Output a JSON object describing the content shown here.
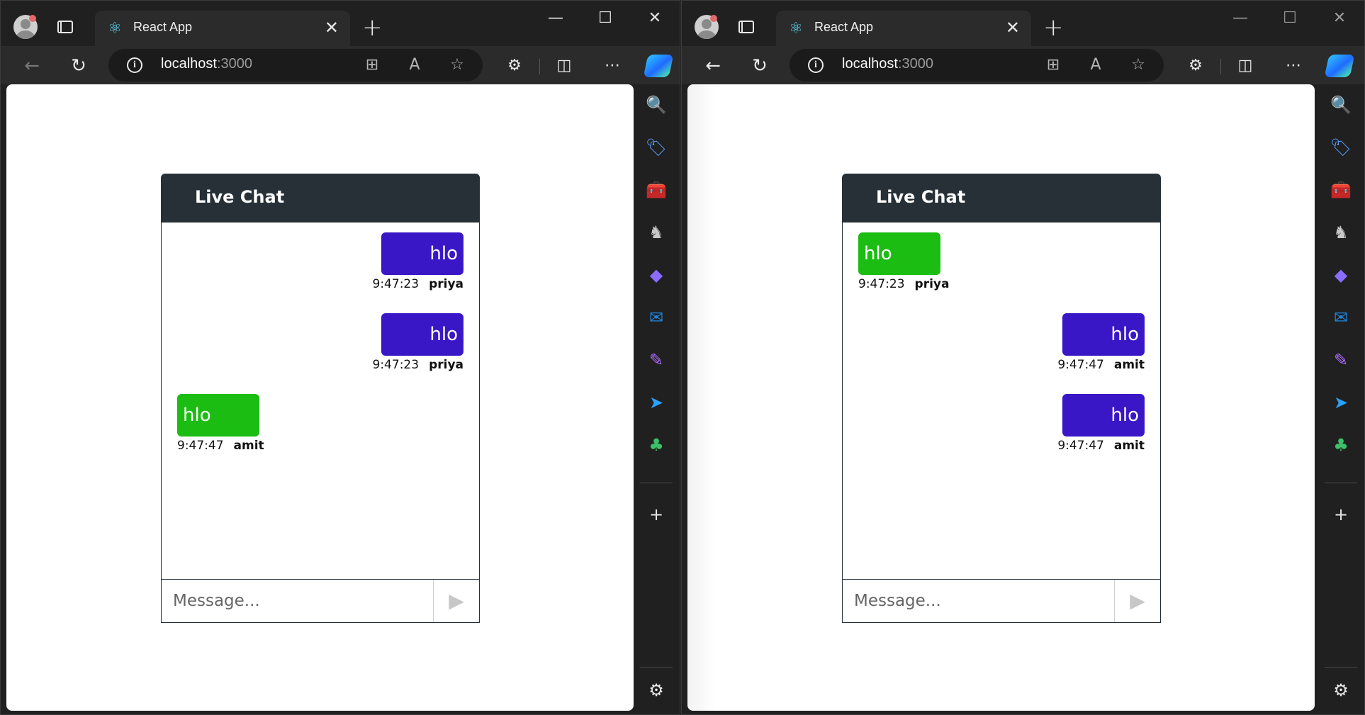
{
  "windows": [
    {
      "tab_title": "React App",
      "url_host": "localhost",
      "url_port": ":3000",
      "chat": {
        "title": "Live Chat",
        "placeholder": "Message...",
        "messages": [
          {
            "text": "hlo",
            "time": "9:47:23",
            "author": "priya",
            "side": "right"
          },
          {
            "text": "hlo",
            "time": "9:47:23",
            "author": "priya",
            "side": "right"
          },
          {
            "text": "hlo",
            "time": "9:47:47",
            "author": "amit",
            "side": "left"
          }
        ]
      }
    },
    {
      "tab_title": "React App",
      "url_host": "localhost",
      "url_port": ":3000",
      "chat": {
        "title": "Live Chat",
        "placeholder": "Message...",
        "messages": [
          {
            "text": "hlo",
            "time": "9:47:23",
            "author": "priya",
            "side": "left"
          },
          {
            "text": "hlo",
            "time": "9:47:47",
            "author": "amit",
            "side": "right"
          },
          {
            "text": "hlo",
            "time": "9:47:47",
            "author": "amit",
            "side": "right"
          }
        ]
      }
    }
  ],
  "colors": {
    "own_bubble": "#3a17c6",
    "other_bubble": "#1bbd12",
    "header": "#263036"
  },
  "icons": {
    "sidebar": [
      "search-icon",
      "tag-icon",
      "toolbox-icon",
      "chess-icon",
      "copilot-icon",
      "outlook-icon",
      "designer-icon",
      "send-icon",
      "tree-icon",
      "add-icon",
      "settings-icon"
    ]
  }
}
